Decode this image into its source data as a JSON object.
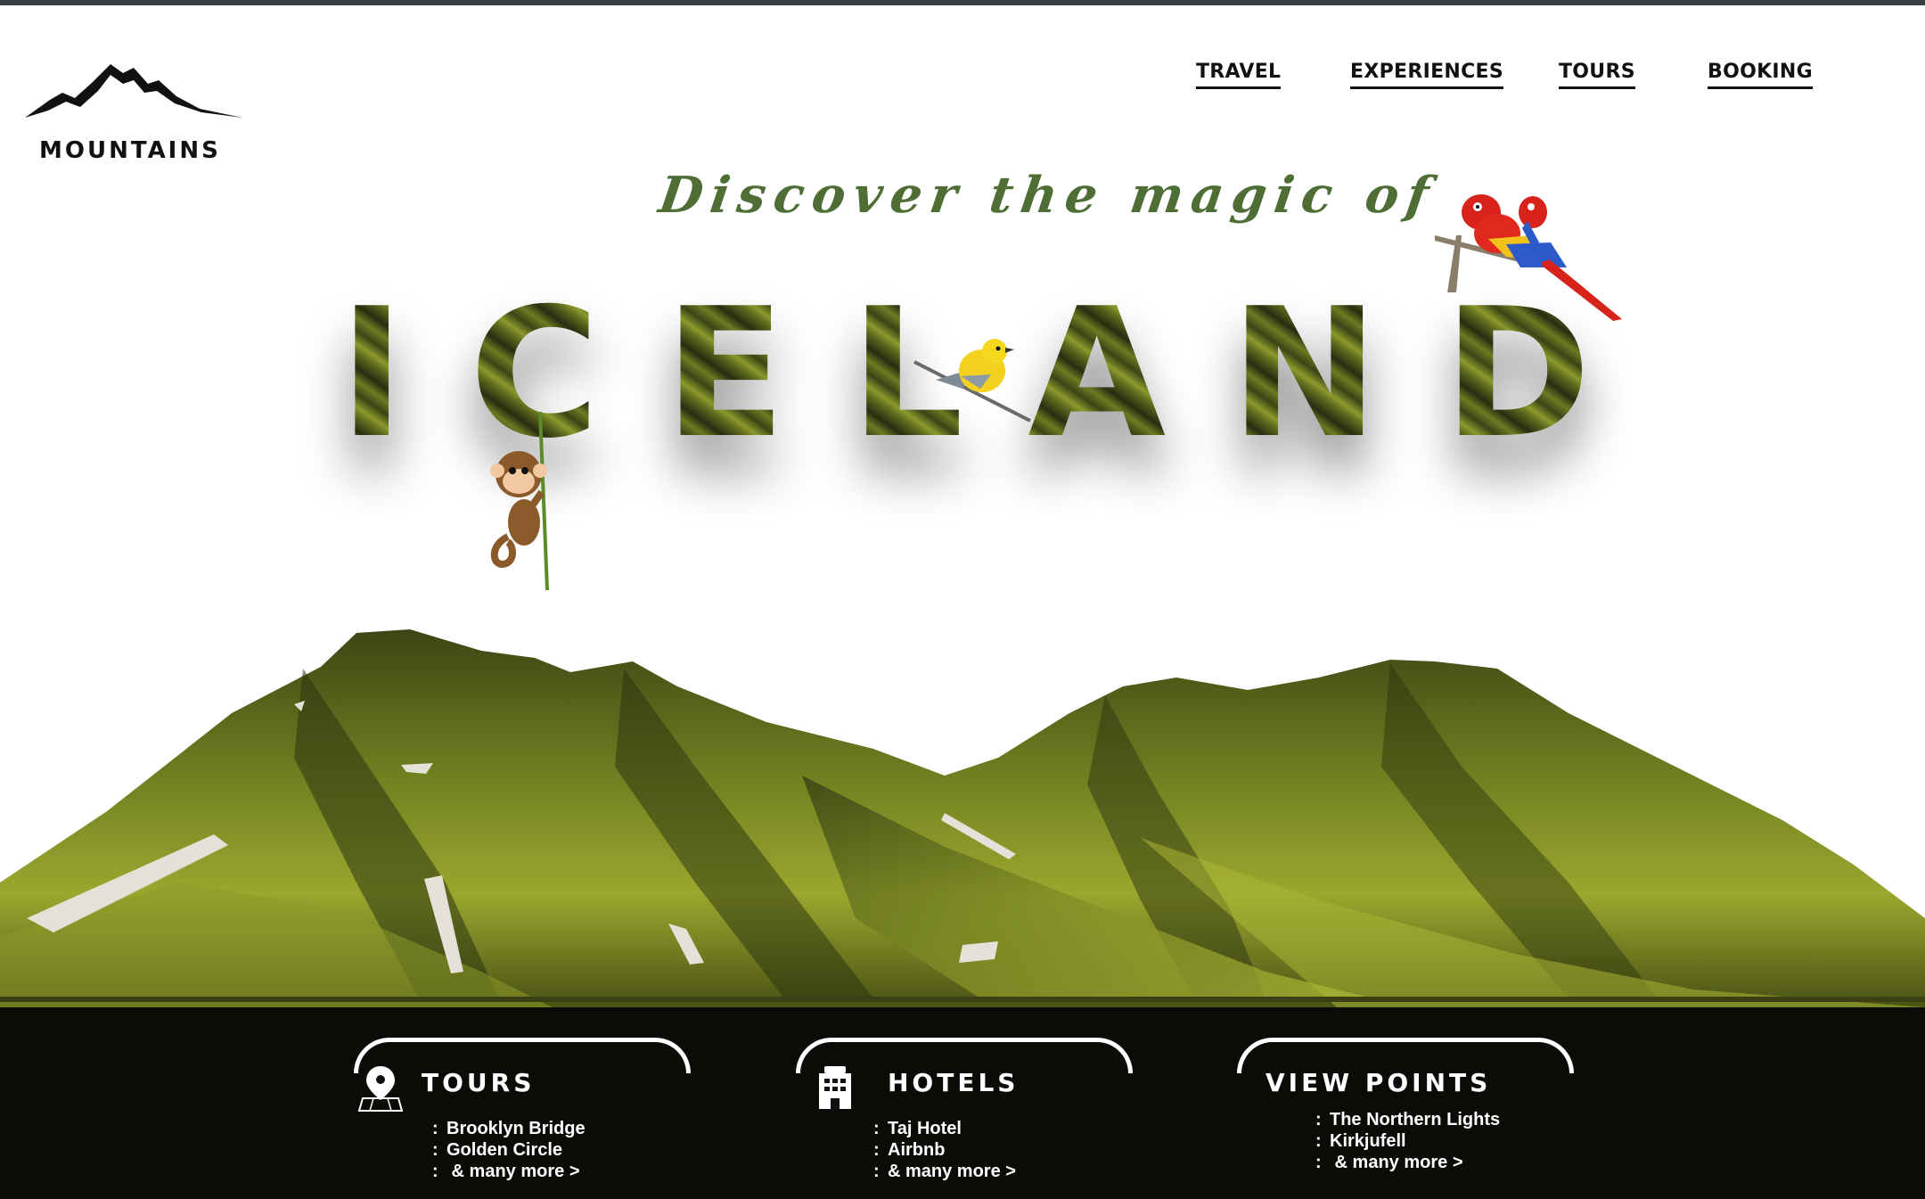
{
  "brand": {
    "name": "MOUNTAINS",
    "icon": "mountain-logo-icon"
  },
  "nav": {
    "items": [
      "TRAVEL",
      "EXPERIENCES",
      "TOURS",
      "BOOKING"
    ]
  },
  "hero": {
    "tagline": "Discover the magic of",
    "title": "ICELAND"
  },
  "cards": [
    {
      "title": "TOURS",
      "icon": "map-pin-icon",
      "items": [
        "Brooklyn Bridge",
        "Golden Circle",
        " & many more  >"
      ]
    },
    {
      "title": "HOTELS",
      "icon": "hotel-building-icon",
      "items": [
        "Taj Hotel",
        "Airbnb",
        "& many more  >"
      ]
    },
    {
      "title": "VIEW POINTS",
      "icon": "",
      "items": [
        "The Northern Lights",
        "Kirkjufell",
        " & many more  >"
      ]
    }
  ],
  "colors": {
    "tagline_green": "#4e6e36",
    "moss": "#8c9a2c",
    "ground": "#0b0c08",
    "text_dark": "#111111"
  }
}
